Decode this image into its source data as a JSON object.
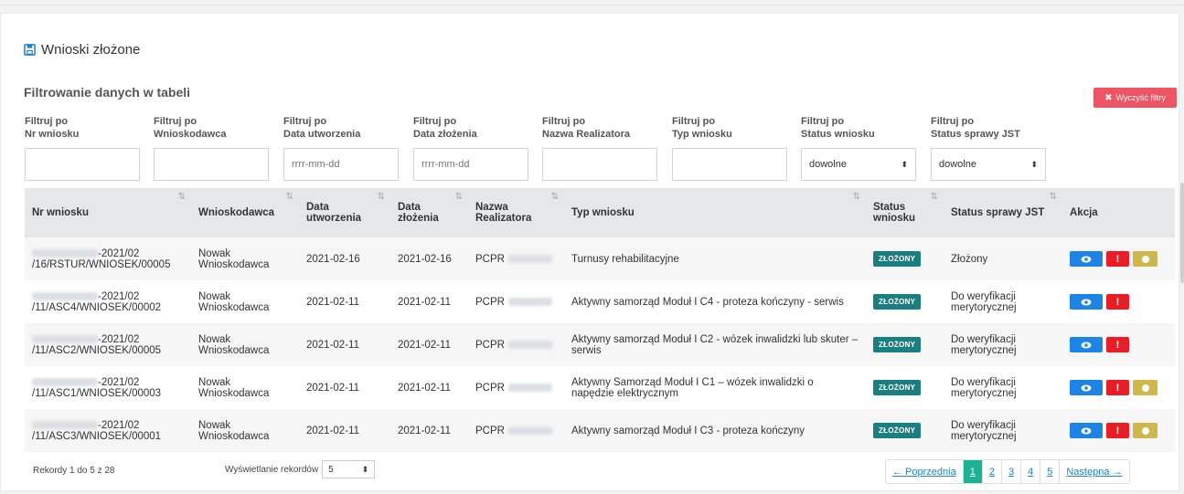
{
  "title": "Wnioski złożone",
  "filter_heading": "Filtrowanie danych w tabeli",
  "clear_filters": "Wyczyść filtry",
  "filters": [
    {
      "l1": "Filtruj po",
      "l2": "Nr wniosku",
      "type": "text",
      "placeholder": ""
    },
    {
      "l1": "Filtruj po",
      "l2": "Wnioskodawca",
      "type": "text",
      "placeholder": ""
    },
    {
      "l1": "Filtruj po",
      "l2": "Data utworzenia",
      "type": "text",
      "placeholder": "rrrr-mm-dd"
    },
    {
      "l1": "Filtruj po",
      "l2": "Data złożenia",
      "type": "text",
      "placeholder": "rrrr-mm-dd"
    },
    {
      "l1": "Filtruj po",
      "l2": "Nazwa Realizatora",
      "type": "text",
      "placeholder": ""
    },
    {
      "l1": "Filtruj po",
      "l2": "Typ wniosku",
      "type": "text",
      "placeholder": ""
    },
    {
      "l1": "Filtruj po",
      "l2": "Status wniosku",
      "type": "select",
      "value": "dowolne"
    },
    {
      "l1": "Filtruj po",
      "l2": "Status sprawy JST",
      "type": "select",
      "value": "dowolne"
    }
  ],
  "columns": [
    {
      "l1": "Nr wniosku",
      "l2": ""
    },
    {
      "l1": "Wnioskodawca",
      "l2": ""
    },
    {
      "l1": "Data",
      "l2": "utworzenia"
    },
    {
      "l1": "Data",
      "l2": "złożenia"
    },
    {
      "l1": "Nazwa",
      "l2": "Realizatora"
    },
    {
      "l1": "Typ wniosku",
      "l2": ""
    },
    {
      "l1": "Status",
      "l2": "wniosku"
    },
    {
      "l1": "Status sprawy JST",
      "l2": ""
    },
    {
      "l1": "Akcja",
      "l2": ""
    }
  ],
  "rows": [
    {
      "nr1": "-2021/02",
      "nr2": "/16/RSTUR/WNIOSEK/00005",
      "wn1": "Nowak",
      "wn2": "Wnioskodawca",
      "created": "2021-02-16",
      "submitted": "2021-02-16",
      "realizator": "PCPR",
      "typ": "Turnusy rehabilitacyjne",
      "status": "ZŁOŻONY",
      "jst": "Złożony",
      "warn": true
    },
    {
      "nr1": "-2021/02",
      "nr2": "/11/ASC4/WNIOSEK/00002",
      "wn1": "Nowak",
      "wn2": "Wnioskodawca",
      "created": "2021-02-11",
      "submitted": "2021-02-11",
      "realizator": "PCPR",
      "typ": "Aktywny samorząd Moduł I C4 - proteza kończyny - serwis",
      "status": "ZŁOŻONY",
      "jst": "Do weryfikacji merytorycznej",
      "warn": false
    },
    {
      "nr1": "-2021/02",
      "nr2": "/11/ASC2/WNIOSEK/00005",
      "wn1": "Nowak",
      "wn2": "Wnioskodawca",
      "created": "2021-02-11",
      "submitted": "2021-02-11",
      "realizator": "PCPR",
      "typ": "Aktywny samorząd Moduł I C2 - wózek inwalidzki lub skuter – serwis",
      "status": "ZŁOŻONY",
      "jst": "Do weryfikacji merytorycznej",
      "warn": false
    },
    {
      "nr1": "-2021/02",
      "nr2": "/11/ASC1/WNIOSEK/00003",
      "wn1": "Nowak",
      "wn2": "Wnioskodawca",
      "created": "2021-02-11",
      "submitted": "2021-02-11",
      "realizator": "PCPR",
      "typ": "Aktywny Samorząd Moduł I C1 – wózek inwalidzki o napędzie elektrycznym",
      "status": "ZŁOŻONY",
      "jst": "Do weryfikacji merytorycznej",
      "warn": true
    },
    {
      "nr1": "-2021/02",
      "nr2": "/11/ASC3/WNIOSEK/00001",
      "wn1": "Nowak",
      "wn2": "Wnioskodawca",
      "created": "2021-02-11",
      "submitted": "2021-02-11",
      "realizator": "PCPR",
      "typ": "Aktywny samorząd Moduł I C3 - proteza kończyny",
      "status": "ZŁOŻONY",
      "jst": "Do weryfikacji merytorycznej",
      "warn": true
    }
  ],
  "info": "Rekordy 1 do 5 z 28",
  "length_label": "Wyświetlanie rekordów",
  "length_value": "5",
  "pager": {
    "prev": "← Poprzednia",
    "pages": [
      "1",
      "2",
      "3",
      "4",
      "5"
    ],
    "next": "Następna →",
    "active": "1"
  },
  "icons": {
    "title": "floppy-disk-icon",
    "clear": "x-icon",
    "sort": "sort-icon",
    "view": "eye-icon",
    "alert": "exclamation-icon",
    "warn": "dot-icon"
  },
  "colors": {
    "clear": "#ed5565",
    "badge": "#1a7f80",
    "view": "#1c84e7",
    "alert": "#ed1c24",
    "warn": "#cfb74b",
    "pager_active": "#1ab394"
  }
}
